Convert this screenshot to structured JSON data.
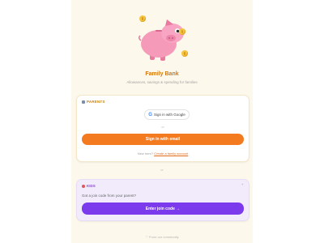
{
  "app": {
    "title": "Family Bank",
    "subtitle": "Allowances, savings & spending for families"
  },
  "parents": {
    "section_label": "PARENTS",
    "google_button": "Sign in with Google",
    "google_glyph": "G",
    "or_label": "or",
    "email_button": "Sign in with email",
    "new_here_text": "New here?",
    "create_account_link": "Create a family account"
  },
  "divider": {
    "or_label": "or"
  },
  "kids": {
    "section_label": "KIDS",
    "question": "Got a join code from your parent?",
    "join_button": "Enter join code →"
  },
  "footer": {
    "community_text": "♡ From our community"
  },
  "icons": {
    "mascot": "piggy-bank-icon",
    "coin": "coin-icon",
    "parents": "parent-icon",
    "kids": "kid-icon",
    "google": "google-icon",
    "sparkle": "sparkle-icon"
  },
  "colors": {
    "page_background": "#fdf8ec",
    "brand_orange": "#f47a1f",
    "title_orange": "#d17a0f",
    "kids_purple": "#7c3aed",
    "kids_card_bg": "#f1ebfb",
    "pig_pink": "#f59ab8"
  }
}
